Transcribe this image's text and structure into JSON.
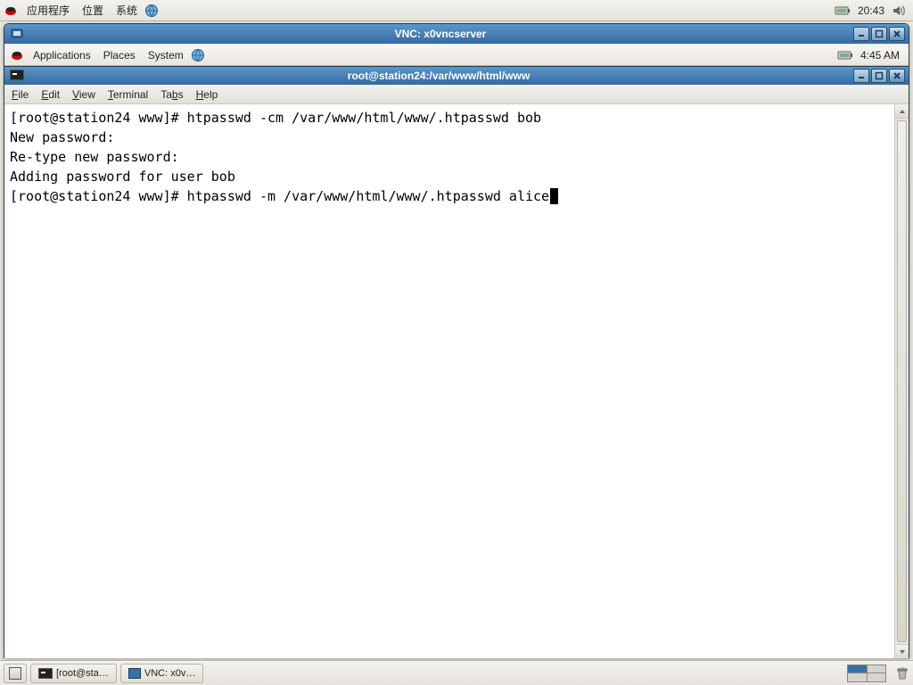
{
  "outer_panel": {
    "menu_apps": "应用程序",
    "menu_places": "位置",
    "menu_system": "系统",
    "clock": "20:43"
  },
  "vnc_window": {
    "title": "VNC: x0vncserver"
  },
  "inner_panel": {
    "menu_apps": "Applications",
    "menu_places": "Places",
    "menu_system": "System",
    "clock": "4:45 AM"
  },
  "terminal": {
    "title": "root@station24:/var/www/html/www",
    "menubar": {
      "file": "File",
      "edit": "Edit",
      "view": "View",
      "terminal": "Terminal",
      "tabs": "Tabs",
      "help": "Help"
    },
    "lines": [
      "[root@station24 www]# htpasswd -cm /var/www/html/www/.htpasswd bob",
      "New password: ",
      "Re-type new password: ",
      "Adding password for user bob",
      "[root@station24 www]# htpasswd -m /var/www/html/www/.htpasswd alice"
    ]
  },
  "outer_taskbar": {
    "task1": "[root@sta…",
    "task2": "VNC: x0v…"
  }
}
